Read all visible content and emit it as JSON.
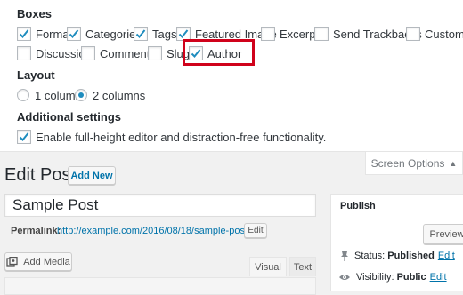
{
  "screen_options": {
    "boxes_title": "Boxes",
    "boxes": [
      {
        "label": "Format",
        "checked": true
      },
      {
        "label": "Categories",
        "checked": true
      },
      {
        "label": "Tags",
        "checked": true
      },
      {
        "label": "Featured Image",
        "checked": true
      },
      {
        "label": "Excerpt",
        "checked": false
      },
      {
        "label": "Send Trackbacks",
        "checked": false
      },
      {
        "label": "Custom Fie",
        "checked": false
      },
      {
        "label": "Discussion",
        "checked": false
      },
      {
        "label": "Comments",
        "checked": false
      },
      {
        "label": "Slug",
        "checked": false
      },
      {
        "label": "Author",
        "checked": true
      }
    ],
    "layout_title": "Layout",
    "layout_options": [
      {
        "label": "1 column",
        "selected": false
      },
      {
        "label": "2 columns",
        "selected": true
      }
    ],
    "additional_title": "Additional settings",
    "additional_label": "Enable full-height editor and distraction-free functionality.",
    "additional_checked": true,
    "tab_label": "Screen Options",
    "tab_arrow": "▲"
  },
  "editor": {
    "page_title": "Edit Post",
    "add_new": "Add New",
    "post_title": "Sample Post",
    "permalink_label": "Permalink:",
    "permalink_url": "http://example.com/2016/08/18/sample-post/",
    "edit_button": "Edit",
    "add_media": "Add Media",
    "tab_visual": "Visual",
    "tab_text": "Text"
  },
  "publish": {
    "title": "Publish",
    "preview": "Preview",
    "status_label": "Status:",
    "status_value": "Published",
    "status_edit": "Edit",
    "visibility_label": "Visibility:",
    "visibility_value": "Public",
    "visibility_edit": "Edit"
  },
  "icons": [
    "check-icon",
    "pin-icon",
    "eye-icon",
    "media-icon",
    "arrow-up-icon"
  ],
  "colors": {
    "accent": "#0073aa",
    "highlight": "#d0021b",
    "checkmark": "#1e8cbe"
  }
}
